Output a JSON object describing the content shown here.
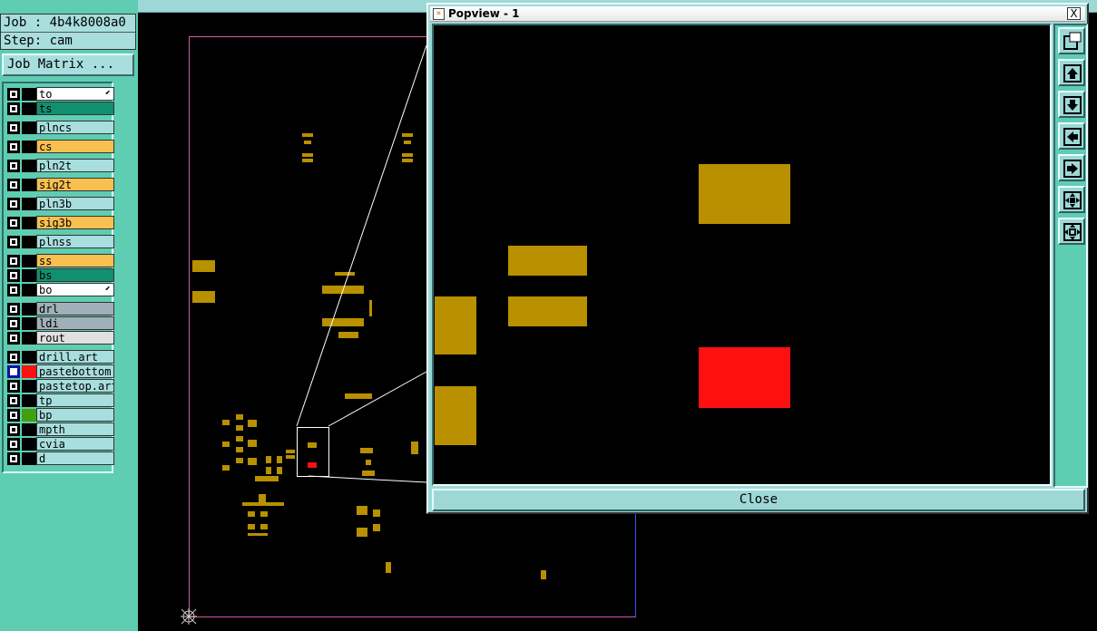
{
  "left": {
    "job_label": "Job : 4b4k8008a0",
    "step_label": "Step: cam",
    "job_matrix_button": "Job Matrix ..."
  },
  "layers": [
    {
      "name": "to",
      "color": "#ffffff",
      "arrow": "⬋",
      "checked": false
    },
    {
      "name": "ts",
      "color": "#109070",
      "checked": false
    },
    {
      "name": "plncs",
      "color": "#a8dede",
      "checked": false
    },
    {
      "name": "cs",
      "color": "#f8c050",
      "checked": false
    },
    {
      "name": "pln2t",
      "color": "#a8dede",
      "checked": false
    },
    {
      "name": "sig2t",
      "color": "#f8c050",
      "checked": false
    },
    {
      "name": "pln3b",
      "color": "#a8dede",
      "checked": false
    },
    {
      "name": "sig3b",
      "color": "#f8c050",
      "checked": false
    },
    {
      "name": "plnss",
      "color": "#a8dede",
      "checked": false
    },
    {
      "name": "ss",
      "color": "#f8c050",
      "checked": false
    },
    {
      "name": "bs",
      "color": "#109070",
      "checked": false
    },
    {
      "name": "bo",
      "color": "#ffffff",
      "arrow": "⬋",
      "checked": false
    },
    {
      "name": "drl",
      "color": "#a0b0b8",
      "checked": false
    },
    {
      "name": "ldi",
      "color": "#a0b0b8",
      "checked": false
    },
    {
      "name": "rout",
      "color": "#e0e0e0",
      "checked": false
    },
    {
      "name": "drill.art",
      "color": "#a8dede",
      "checked": false
    },
    {
      "name": "pastebottom",
      "color": "#a8dede",
      "checked": true,
      "swatch": "#ff1010"
    },
    {
      "name": "pastetop.art",
      "color": "#a8dede",
      "checked": false
    },
    {
      "name": "tp",
      "color": "#a8dede",
      "checked": false
    },
    {
      "name": "bp",
      "color": "#a8dede",
      "checked": false,
      "swatch": "#40a010"
    },
    {
      "name": "mpth",
      "color": "#a8dede",
      "checked": false
    },
    {
      "name": "cvia",
      "color": "#a8dede",
      "checked": false
    },
    {
      "name": "d",
      "color": "#a8dede",
      "checked": false
    }
  ],
  "popview": {
    "title": "Popview - 1",
    "close_x": "X",
    "close_button": "Close",
    "tools": [
      "zoom-window-icon",
      "pan-up-icon",
      "pan-down-icon",
      "pan-left-icon",
      "pan-right-icon",
      "zoom-in-icon",
      "zoom-fit-icon"
    ]
  },
  "colors": {
    "copper": "#b89000",
    "paste_highlight": "#ff1010",
    "panel_bg": "#5fcdb2",
    "button_bg": "#9ed8d6"
  }
}
